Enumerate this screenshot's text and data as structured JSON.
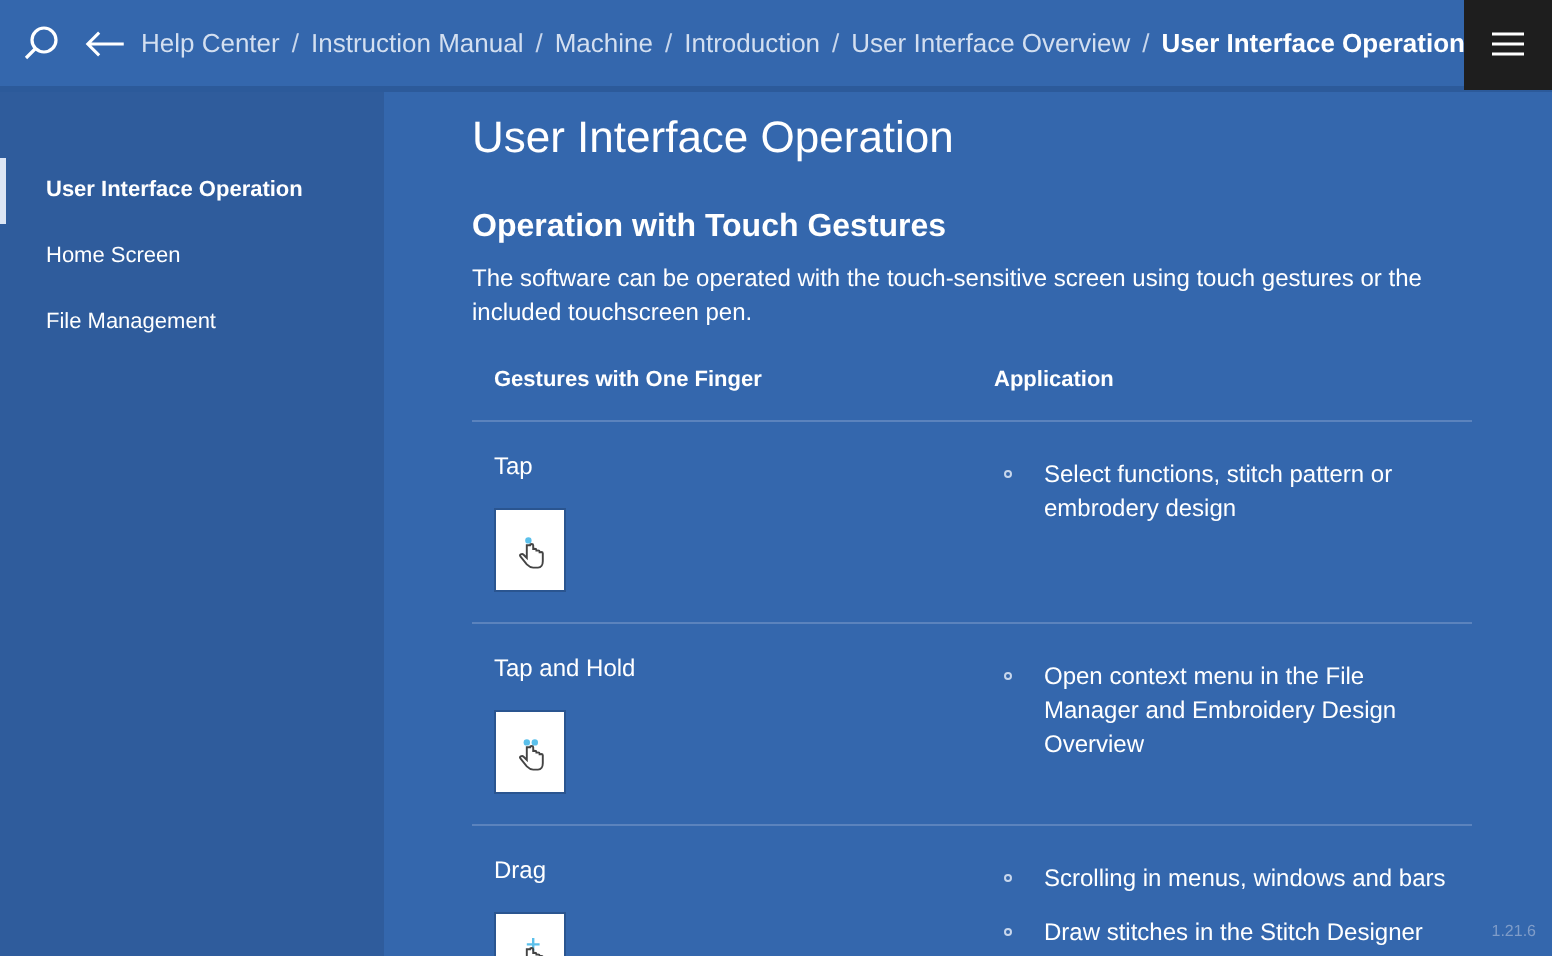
{
  "breadcrumb_separator": "/",
  "breadcrumb": [
    {
      "label": "Help Center",
      "current": false
    },
    {
      "label": "Instruction Manual",
      "current": false
    },
    {
      "label": "Machine",
      "current": false
    },
    {
      "label": "Introduction",
      "current": false
    },
    {
      "label": "User Interface Overview",
      "current": false
    },
    {
      "label": "User Interface Operation",
      "current": true
    }
  ],
  "sidebar": {
    "items": [
      {
        "label": "User Interface Operation",
        "selected": true
      },
      {
        "label": "Home Screen",
        "selected": false
      },
      {
        "label": "File Management",
        "selected": false
      }
    ]
  },
  "page_title": "User Interface Operation",
  "section_title": "Operation with Touch Gestures",
  "intro": "The software can be operated with the touch-sensitive screen using touch gestures or the included touchscreen pen.",
  "table": {
    "columns": [
      "Gestures with One Finger",
      "Application"
    ],
    "rows": [
      {
        "gesture": "Tap",
        "kind": "tap",
        "applications": [
          "Select functions, stitch pattern or embrodery design"
        ]
      },
      {
        "gesture": "Tap and Hold",
        "kind": "hold",
        "applications": [
          "Open context menu in the File Manager and Embroidery Design Overview"
        ]
      },
      {
        "gesture": "Drag",
        "kind": "drag",
        "applications": [
          "Scrolling in menus, windows and bars",
          "Draw stitches in the Stitch Designer"
        ]
      }
    ]
  },
  "version": "1.21.6"
}
